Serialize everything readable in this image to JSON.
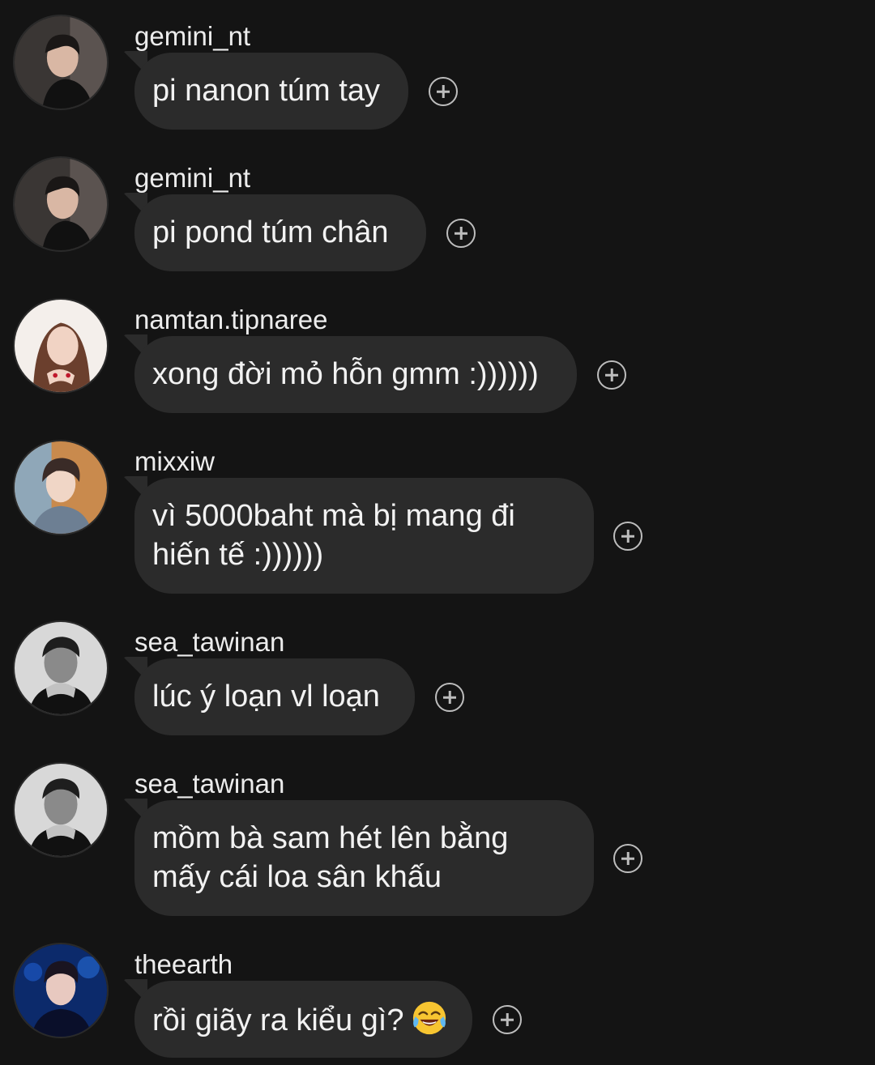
{
  "messages": [
    {
      "username": "gemini_nt",
      "lines": [
        "pi nanon túm tay"
      ],
      "avatar": "avatar-gemini-nt"
    },
    {
      "username": "gemini_nt",
      "lines": [
        "pi pond túm chân"
      ],
      "avatar": "avatar-gemini-nt"
    },
    {
      "username": "namtan.tipnaree",
      "lines": [
        "xong đời mỏ hỗn gmm :))))))"
      ],
      "avatar": "avatar-namtan-tipnaree"
    },
    {
      "username": "mixxiw",
      "lines": [
        "vì 5000baht mà bị mang đi",
        "hiến tế  :))))))"
      ],
      "avatar": "avatar-mixxiw"
    },
    {
      "username": "sea_tawinan",
      "lines": [
        "lúc ý loạn vl loạn"
      ],
      "avatar": "avatar-sea-tawinan"
    },
    {
      "username": "sea_tawinan",
      "lines": [
        "mồm bà sam hét lên bằng",
        "mấy cái loa sân khấu"
      ],
      "avatar": "avatar-sea-tawinan"
    },
    {
      "username": "theearth",
      "lines": [
        "rồi giãy ra kiểu gì?"
      ],
      "emoji": "face-with-tears-of-joy-icon",
      "avatar": "avatar-theearth"
    }
  ],
  "icons": {
    "reaction": "add-reaction-icon"
  },
  "colors": {
    "background": "#141414",
    "bubble": "#2b2b2b",
    "text": "#f2f2f2",
    "username": "#ececec",
    "icon": "#bdbdbd"
  }
}
